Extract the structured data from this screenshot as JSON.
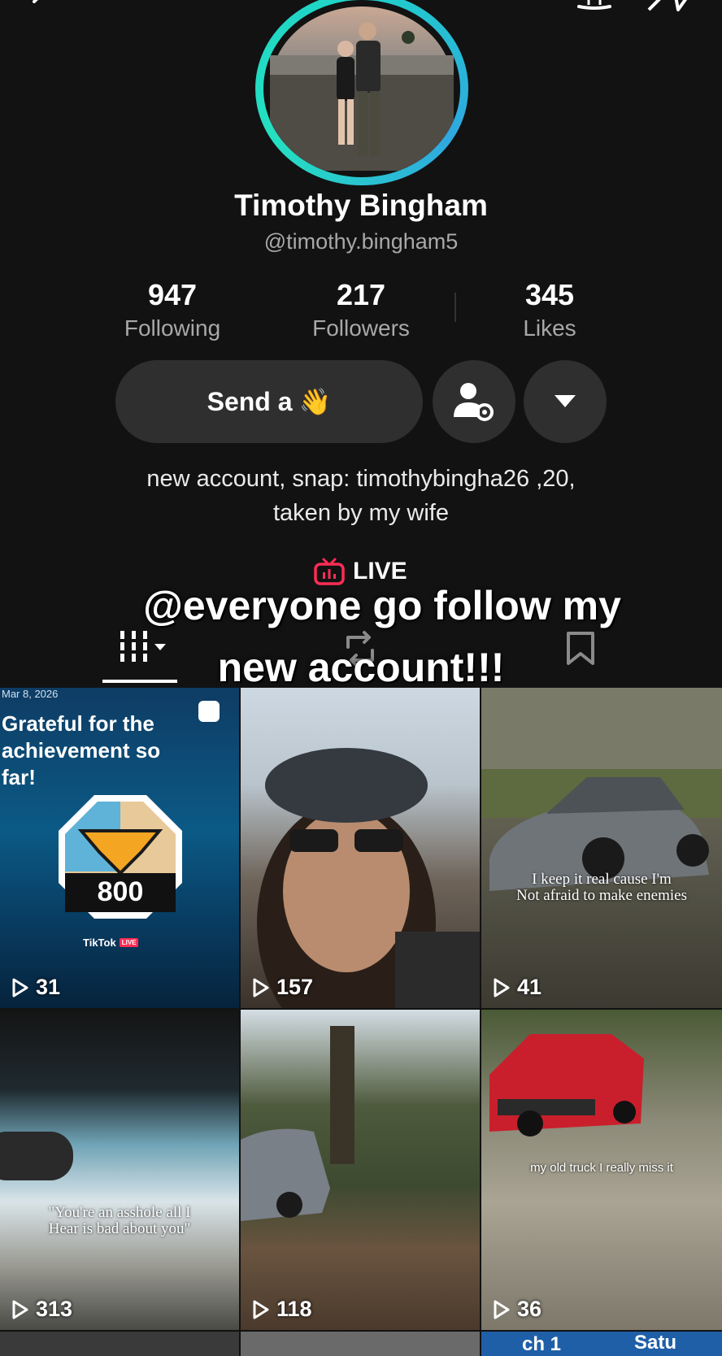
{
  "profile": {
    "name": "Timothy Bingham",
    "handle": "@timothy.bingham5",
    "bio_line1": "new account, snap: timothybingha26 ,20,",
    "bio_line2": "taken by my wife"
  },
  "stats": [
    {
      "value": "947",
      "label": "Following"
    },
    {
      "value": "217",
      "label": "Followers"
    },
    {
      "value": "345",
      "label": "Likes"
    }
  ],
  "actions": {
    "send_label": "Send a",
    "send_emoji": "👋"
  },
  "live_label": "LIVE",
  "overlay": {
    "line1": "@everyone go follow my",
    "line2": "new account!!!"
  },
  "videos": [
    {
      "date": "Mar 8, 2026",
      "title": "Grateful for the achievement so far!",
      "badge_number": "800",
      "brand": "TikTok",
      "brand_tag": "LIVE",
      "views": "31"
    },
    {
      "views": "157"
    },
    {
      "caption_line1": "I keep it real cause I'm",
      "caption_line2": "Not afraid to make enemies",
      "views": "41"
    },
    {
      "caption_line1": "\"You're an asshole all I",
      "caption_line2": "Hear is bad about you\"",
      "views": "313"
    },
    {
      "views": "118"
    },
    {
      "caption_line1": "my old truck I really miss it",
      "views": "36"
    },
    {
      "partial_text": "ch 1"
    },
    {},
    {
      "partial_text": "Satu"
    }
  ],
  "colors": {
    "background": "#121212",
    "button": "#2f2f2f",
    "ring": "#1fd1c8",
    "live_red": "#fe2c55"
  }
}
